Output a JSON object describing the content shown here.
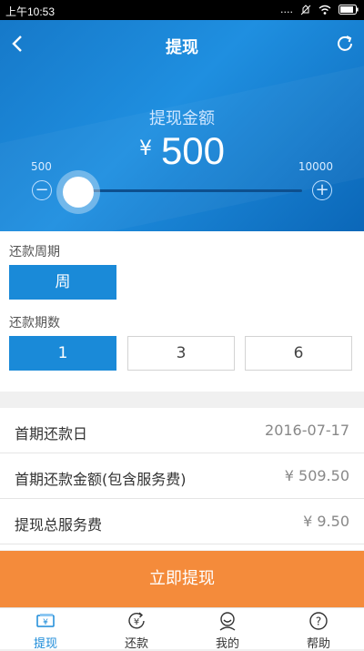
{
  "statusbar": {
    "time": "上午10:53",
    "signal": "....",
    "battery_icon": "battery-icon"
  },
  "header": {
    "title": "提现"
  },
  "amount": {
    "label": "提现金额",
    "currency": "¥",
    "value": "500",
    "min": "500",
    "max": "10000",
    "slider_fraction": 0.0
  },
  "repay_period": {
    "label": "还款周期",
    "options": [
      "周"
    ],
    "selected": "周"
  },
  "repay_count": {
    "label": "还款期数",
    "options": [
      "1",
      "3",
      "6"
    ],
    "selected": "1"
  },
  "details": {
    "rows": [
      {
        "label": "首期还款日",
        "value": "2016-07-17"
      },
      {
        "label": "首期还款金额(包含服务费)",
        "value": "¥ 509.50"
      },
      {
        "label": "提现总服务费",
        "value": "¥ 9.50"
      }
    ]
  },
  "cta": {
    "label": "立即提现"
  },
  "tabs": [
    {
      "label": "提现",
      "icon": "withdraw-icon",
      "active": true
    },
    {
      "label": "还款",
      "icon": "repay-icon",
      "active": false
    },
    {
      "label": "我的",
      "icon": "profile-icon",
      "active": false
    },
    {
      "label": "帮助",
      "icon": "help-icon",
      "active": false
    }
  ],
  "colors": {
    "accent": "#1a8ad8",
    "cta": "#f48b3b",
    "hero": "#1f8fe0"
  }
}
